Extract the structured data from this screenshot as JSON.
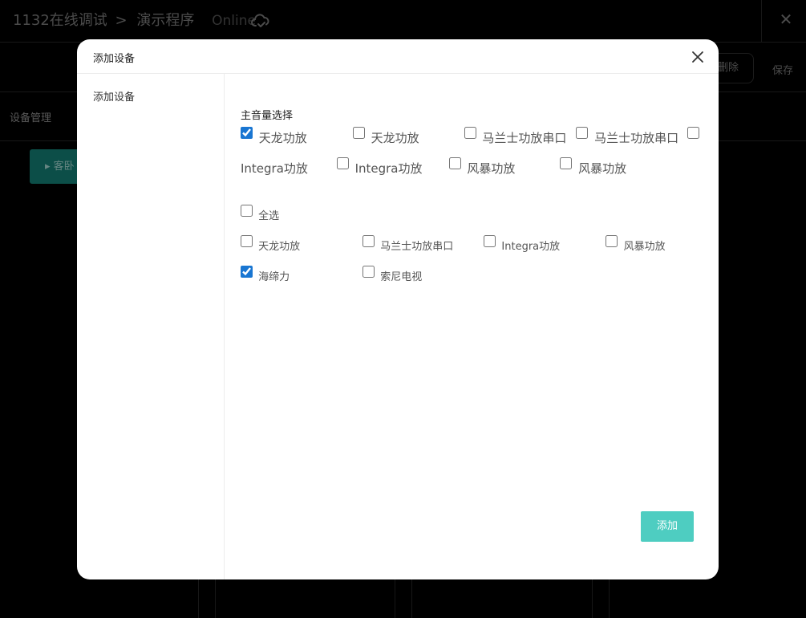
{
  "app": {
    "breadcrumb_root": "1132在线调试",
    "breadcrumb_sep": ">",
    "breadcrumb_current": "演示程序",
    "status": "Online",
    "toolbar_delete": "删除",
    "toolbar_save": "保存",
    "tab_devices": "设备管理",
    "room_button": "客卧"
  },
  "modal": {
    "title": "添加设备",
    "sidebar_item": "添加设备",
    "section_title": "主音量选择",
    "volume_row1": [
      {
        "label": "天龙功放",
        "checked": true
      },
      {
        "label": "天龙功放",
        "checked": false
      },
      {
        "label": "马兰士功放串口",
        "checked": false
      },
      {
        "label": "马兰士功放串口",
        "checked": false
      }
    ],
    "volume_row2_lead": "Integra功放",
    "volume_row2": [
      {
        "label": "Integra功放",
        "checked": false
      },
      {
        "label": "风暴功放",
        "checked": false
      },
      {
        "label": "风暴功放",
        "checked": false
      }
    ],
    "select_all": "全选",
    "devices": [
      {
        "label": "天龙功放",
        "checked": false
      },
      {
        "label": "马兰士功放串口",
        "checked": false
      },
      {
        "label": "Integra功放",
        "checked": false
      },
      {
        "label": "风暴功放",
        "checked": false
      },
      {
        "label": "海缔力",
        "checked": true
      },
      {
        "label": "索尼电视",
        "checked": false
      }
    ],
    "add_button": "添加"
  },
  "colors": {
    "accent": "#4ecdc1",
    "checkbox": "#1976d2",
    "room_button": "#0f5c55"
  }
}
